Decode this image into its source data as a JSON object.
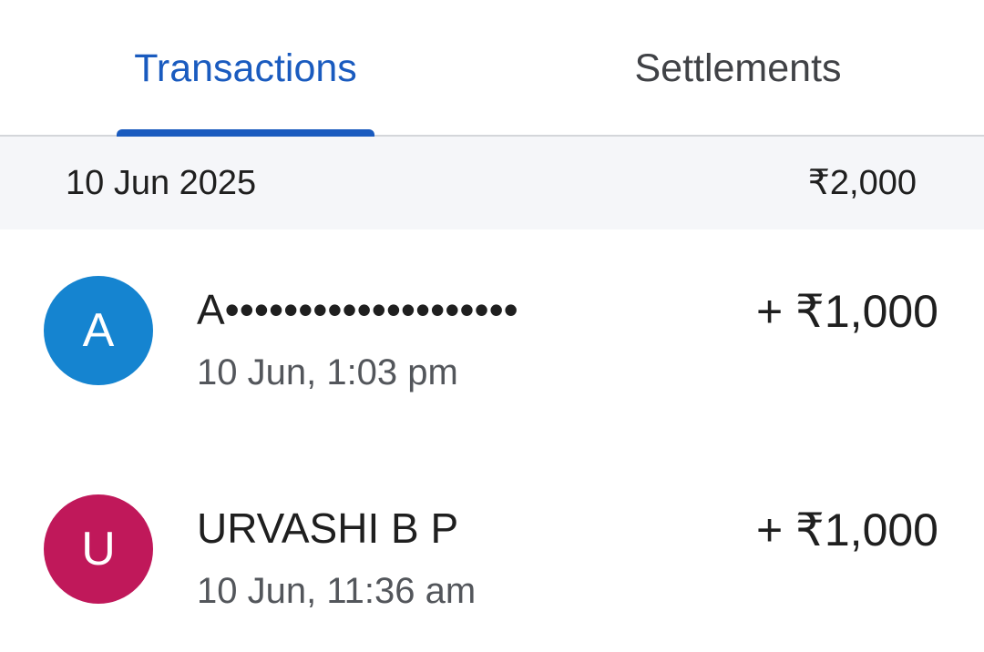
{
  "tabs": [
    {
      "label": "Transactions",
      "active": true
    },
    {
      "label": "Settlements",
      "active": false
    }
  ],
  "colors": {
    "accent": "#1a5bbf",
    "header_bg": "#f5f6f9"
  },
  "group": {
    "date": "10 Jun 2025",
    "total": "₹2,000"
  },
  "transactions": [
    {
      "initial": "A",
      "avatar_color": "#1584d0",
      "name": "A••••••••••••••••••••",
      "time": "10 Jun, 1:03 pm",
      "amount": "+ ₹1,000"
    },
    {
      "initial": "U",
      "avatar_color": "#c0185a",
      "name": "URVASHI B P",
      "time": "10 Jun, 11:36 am",
      "amount": "+ ₹1,000"
    }
  ]
}
